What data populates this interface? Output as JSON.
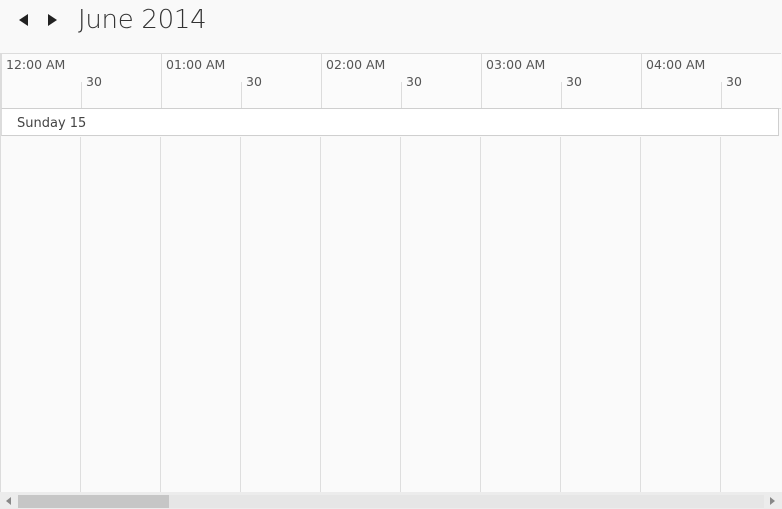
{
  "header": {
    "title": "June 2014",
    "prev_icon": "triangle-left-icon",
    "next_icon": "triangle-right-icon"
  },
  "timeline": {
    "hours": [
      {
        "label": "12:00 AM",
        "half": "30"
      },
      {
        "label": "01:00 AM",
        "half": "30"
      },
      {
        "label": "02:00 AM",
        "half": "30"
      },
      {
        "label": "03:00 AM",
        "half": "30"
      },
      {
        "label": "04:00 AM",
        "half": "30"
      }
    ]
  },
  "day": {
    "label": "Sunday 15"
  },
  "scrollbar": {
    "left_icon": "scroll-left-icon",
    "right_icon": "scroll-right-icon",
    "position": 0
  },
  "colors": {
    "background": "#f9f9f9",
    "grid_line": "#dedede",
    "thumb": "#c6c6c6"
  }
}
